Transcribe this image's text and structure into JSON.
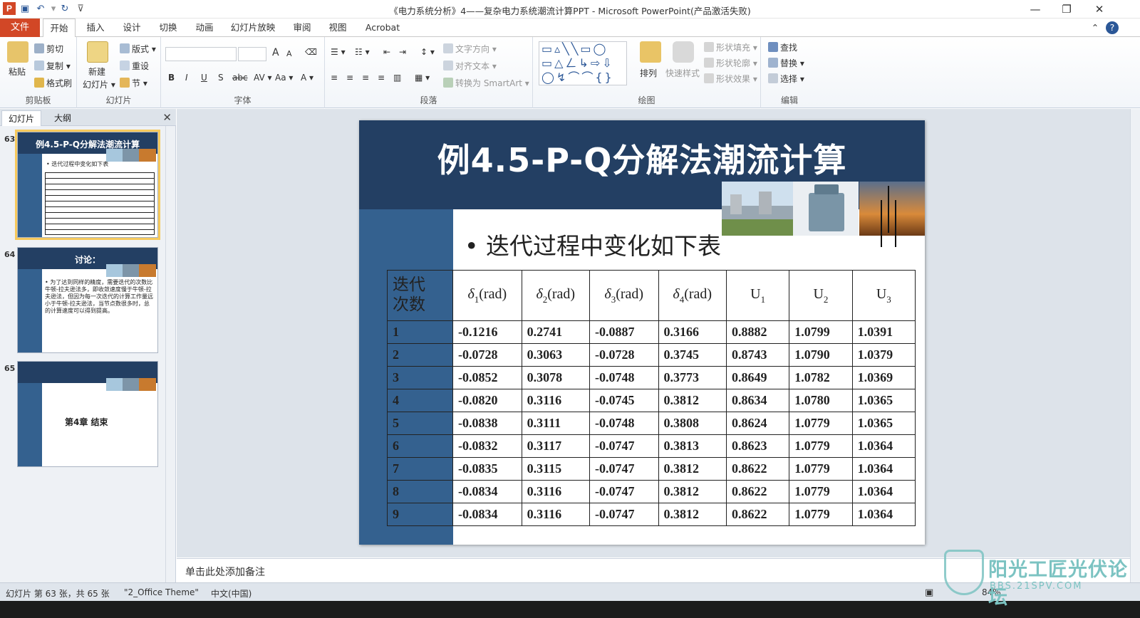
{
  "window": {
    "title": "《电力系统分析》4——复杂电力系统潮流计算PPT  -  Microsoft PowerPoint(产品激活失败)",
    "app_logo": "P"
  },
  "tabs": {
    "file": "文件",
    "items": [
      "开始",
      "插入",
      "设计",
      "切换",
      "动画",
      "幻灯片放映",
      "审阅",
      "视图",
      "Acrobat"
    ]
  },
  "ribbon": {
    "clipboard": {
      "paste": "粘贴",
      "cut": "剪切",
      "copy": "复制 ▾",
      "format_painter": "格式刷",
      "label": "剪贴板"
    },
    "slides": {
      "new_slide": "新建",
      "new_slide2": "幻灯片 ▾",
      "layout": "版式 ▾",
      "reset": "重设",
      "section": "节 ▾",
      "label": "幻灯片"
    },
    "font": {
      "label": "字体",
      "bold": "B",
      "italic": "I",
      "underline": "U",
      "shadow": "S",
      "strike": "abc",
      "spacing": "AV ▾",
      "case": "Aa ▾",
      "color": "A ▾",
      "grow": "A",
      "shrink": "A"
    },
    "paragraph": {
      "text_direction": "文字方向 ▾",
      "align_text": "对齐文本 ▾",
      "smartart": "转换为 SmartArt ▾",
      "label": "段落"
    },
    "drawing": {
      "arrange": "排列",
      "quick_styles": "快速样式",
      "fill": "形状填充 ▾",
      "outline": "形状轮廓 ▾",
      "effects": "形状效果 ▾",
      "label": "绘图"
    },
    "editing": {
      "find": "查找",
      "replace": "替换 ▾",
      "select": "选择 ▾",
      "label": "编辑"
    }
  },
  "panel": {
    "tab_slides": "幻灯片",
    "tab_outline": "大纲",
    "thumbs": [
      {
        "num": "63",
        "title": "例4.5-P-Q分解法潮流计算",
        "bullet": "• 迭代过程中变化如下表"
      },
      {
        "num": "64",
        "title": "讨论：",
        "text": "• 为了达到同样的精度，需要迭代的次数比牛顿-拉夫逊法多，即收敛速度慢于牛顿-拉夫逊法，但因为每一次迭代的计算工作量远小于牛顿-拉夫逊法，当节点数很多时，总的计算速度可以得到提高。"
      },
      {
        "num": "65",
        "text": "第4章 结束"
      }
    ]
  },
  "slide": {
    "title": "例4.5-P-Q分解法潮流计算",
    "bullet": "•  迭代过程中变化如下表",
    "table": {
      "header_first_line1": "迭代",
      "header_first_line2": "次数",
      "headers": [
        {
          "sym": "δ",
          "sub": "1",
          "unit": "(rad)"
        },
        {
          "sym": "δ",
          "sub": "2",
          "unit": "(rad)"
        },
        {
          "sym": "δ",
          "sub": "3",
          "unit": "(rad)"
        },
        {
          "sym": "δ",
          "sub": "4",
          "unit": "(rad)"
        },
        {
          "sym": "U",
          "sub": "1",
          "unit": ""
        },
        {
          "sym": "U",
          "sub": "2",
          "unit": ""
        },
        {
          "sym": "U",
          "sub": "3",
          "unit": ""
        }
      ],
      "rows": [
        [
          "1",
          "-0.1216",
          "0.2741",
          "-0.0887",
          "0.3166",
          "0.8882",
          "1.0799",
          "1.0391"
        ],
        [
          "2",
          "-0.0728",
          "0.3063",
          "-0.0728",
          "0.3745",
          "0.8743",
          "1.0790",
          "1.0379"
        ],
        [
          "3",
          "-0.0852",
          "0.3078",
          "-0.0748",
          "0.3773",
          "0.8649",
          "1.0782",
          "1.0369"
        ],
        [
          "4",
          "-0.0820",
          "0.3116",
          "-0.0745",
          "0.3812",
          "0.8634",
          "1.0780",
          "1.0365"
        ],
        [
          "5",
          "-0.0838",
          "0.3111",
          "-0.0748",
          "0.3808",
          "0.8624",
          "1.0779",
          "1.0365"
        ],
        [
          "6",
          "-0.0832",
          "0.3117",
          "-0.0747",
          "0.3813",
          "0.8623",
          "1.0779",
          "1.0364"
        ],
        [
          "7",
          "-0.0835",
          "0.3115",
          "-0.0747",
          "0.3812",
          "0.8622",
          "1.0779",
          "1.0364"
        ],
        [
          "8",
          "-0.0834",
          "0.3116",
          "-0.0747",
          "0.3812",
          "0.8622",
          "1.0779",
          "1.0364"
        ],
        [
          "9",
          "-0.0834",
          "0.3116",
          "-0.0747",
          "0.3812",
          "0.8622",
          "1.0779",
          "1.0364"
        ]
      ]
    }
  },
  "notes": {
    "placeholder": "单击此处添加备注"
  },
  "status": {
    "slide_info": "幻灯片 第 63 张，共 65 张",
    "theme": "\"2_Office Theme\"",
    "language": "中文(中国)",
    "zoom": "84%"
  },
  "watermark": {
    "text": "阳光工匠光伏论坛",
    "url": "BBS.21SPV.COM"
  },
  "colors": {
    "accent": "#d24726",
    "slide_dark": "#233f63",
    "slide_side": "#34618f"
  }
}
